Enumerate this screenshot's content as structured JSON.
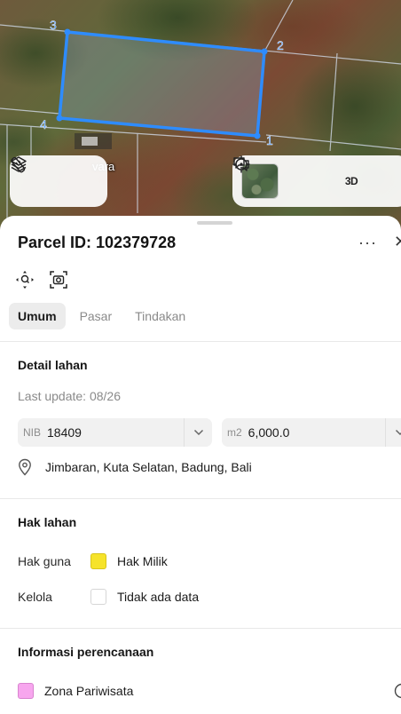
{
  "map": {
    "place_label": "vara",
    "vertex_labels": [
      "1",
      "2",
      "3",
      "4"
    ],
    "colors": {
      "parcel_outline": "#2e8cff",
      "boundary_lines": "#cfd8e6"
    },
    "controls": {
      "left": [
        "layers-icon",
        "measure-icon"
      ],
      "right": [
        "satellite-thumbnail",
        "locate-icon",
        "3d-toggle",
        "feedback-icon"
      ],
      "btn_3d_label": "3D"
    }
  },
  "sheet": {
    "title": "Parcel ID: 102379728",
    "more_label": "···",
    "close_label": "✕",
    "tools": [
      "recenter-icon",
      "screenshot-icon"
    ],
    "tabs": [
      {
        "label": "Umum",
        "active": true
      },
      {
        "label": "Pasar",
        "active": false
      },
      {
        "label": "Tindakan",
        "active": false
      }
    ],
    "detail": {
      "heading": "Detail lahan",
      "last_update": "Last update: 08/26",
      "nib_label": "NIB",
      "nib_value": "18409",
      "area_unit": "m2",
      "area_value": "6,000.0",
      "location": "Jimbaran, Kuta Selatan, Badung, Bali"
    },
    "rights": {
      "heading": "Hak lahan",
      "hak_guna_key": "Hak guna",
      "hak_guna_value": "Hak Milik",
      "hak_guna_color": "#f6e32a",
      "kelola_key": "Kelola",
      "kelola_value": "Tidak ada data",
      "kelola_color": "#ffffff"
    },
    "planning": {
      "heading": "Informasi perencanaan",
      "zone": "Zona Pariwisata",
      "zone_color": "#f7a6ee"
    }
  }
}
